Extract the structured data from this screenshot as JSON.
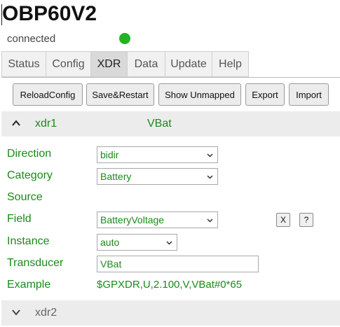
{
  "header": {
    "title": "OBP60V2",
    "connection_status": "connected",
    "status_color": "#22b322"
  },
  "tabs": [
    {
      "label": "Status",
      "active": false
    },
    {
      "label": "Config",
      "active": false
    },
    {
      "label": "XDR",
      "active": true
    },
    {
      "label": "Data",
      "active": false
    },
    {
      "label": "Update",
      "active": false
    },
    {
      "label": "Help",
      "active": false
    }
  ],
  "toolbar": {
    "reload_config": "ReloadConfig",
    "save_restart": "Save&Restart",
    "show_unmapped": "Show Unmapped",
    "export": "Export",
    "import": "Import"
  },
  "xdr1": {
    "name": "xdr1",
    "value": "VBat",
    "expanded": true,
    "labels": {
      "direction": "Direction",
      "category": "Category",
      "source": "Source",
      "field": "Field",
      "instance": "Instance",
      "transducer": "Transducer",
      "example": "Example"
    },
    "direction": "bidir",
    "category": "Battery",
    "field": "BatteryVoltage",
    "instance": "auto",
    "transducer": "VBat",
    "example": "$GPXDR,U,2.100,V,VBat#0*65",
    "clear_button": "X",
    "help_button": "?"
  },
  "xdr2": {
    "name": "xdr2",
    "expanded": false
  },
  "colors": {
    "accent_green": "#1a8a1a",
    "section_bg": "#ececec"
  },
  "icons": {
    "expand": "chevron-up-icon",
    "collapse": "chevron-down-icon",
    "select": "chevron-down-icon"
  }
}
